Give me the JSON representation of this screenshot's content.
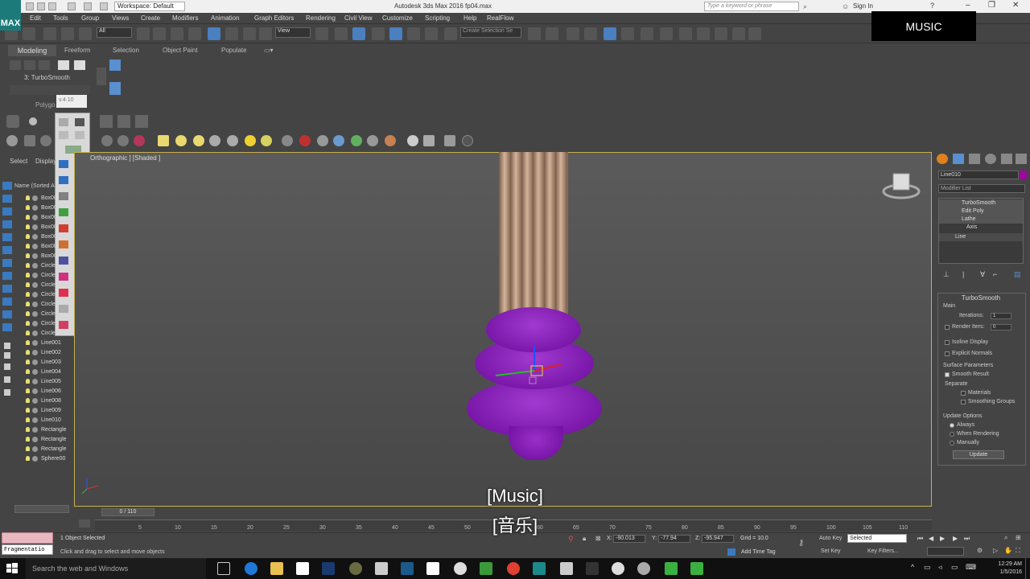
{
  "titlebar": {
    "logo_text": "MAX",
    "workspace": "Workspace: Default",
    "title": "Autodesk 3ds Max 2016    fp04.max",
    "search_placeholder": "Type a keyword or phrase",
    "sign_in": "Sign In"
  },
  "menus": [
    "Edit",
    "Tools",
    "Group",
    "Views",
    "Create",
    "Modifiers",
    "Animation",
    "Graph Editors",
    "Rendering",
    "Civil View",
    "Customize",
    "Scripting",
    "Help",
    "RealFlow"
  ],
  "toolbar": {
    "selection_filter": "All",
    "reference_coord": "View",
    "named_selection": "Create Selection Se"
  },
  "overlay": {
    "music_badge": "MUSIC"
  },
  "ribbon": {
    "tabs": [
      "Modeling",
      "Freeform",
      "Selection",
      "Object Paint",
      "Populate"
    ],
    "modifier_label": "3: TurboSmooth",
    "polygon_label": "Polygo",
    "version_tooltip": "v.4.10"
  },
  "explorer": {
    "tabs": [
      "Select",
      "Display"
    ],
    "header": "Name (Sorted A",
    "objects": [
      "Box00",
      "Box00",
      "Box00",
      "Box00",
      "Box00",
      "Box00",
      "Box00",
      "Circle",
      "Circle",
      "Circle",
      "Circle",
      "Circle",
      "Circle",
      "Circle",
      "Circle",
      "Line001",
      "Line002",
      "Line003",
      "Line004",
      "Line005",
      "Line006",
      "Line008",
      "Line009",
      "Line010",
      "Rectangle",
      "Rectangle",
      "Rectangle",
      "Sphere00"
    ]
  },
  "viewport": {
    "label": "Orthographic ] [Shaded ]",
    "column_color": "#c9a78d",
    "ring_color": "#8a1ec0"
  },
  "command_panel": {
    "object_name": "Line010",
    "object_color": "#9a0a9a",
    "modifier_list": "Modifier List",
    "stack": [
      "TurboSmooth",
      "Edit Poly",
      "Lathe",
      "Axis",
      "Line"
    ],
    "rollout_title": "TurboSmooth",
    "main_label": "Main",
    "iterations_label": "Iterations:",
    "iterations_value": "1",
    "render_iters_label": "Render Iters:",
    "render_iters_value": "0",
    "isoline_display": "Isoline Display",
    "explicit_normals": "Explicit Normals",
    "surface_params": "Surface Parameters",
    "smooth_result": "Smooth Result",
    "separate": "Separate",
    "materials": "Materials",
    "smoothing_groups": "Smoothing Groups",
    "update_options": "Update Options",
    "always": "Always",
    "when_rendering": "When Rendering",
    "manually": "Manually",
    "update_button": "Update"
  },
  "timeline": {
    "slider": "0 / 110",
    "ticks": [
      "5",
      "10",
      "15",
      "20",
      "25",
      "30",
      "35",
      "40",
      "45",
      "50",
      "55",
      "60",
      "65",
      "70",
      "75",
      "80",
      "85",
      "90",
      "95",
      "100",
      "105",
      "110"
    ]
  },
  "status": {
    "fragment_text": "Fragmentatio",
    "selected": "1 Object Selected",
    "prompt": "Click and drag to select and move objects",
    "x_label": "X:",
    "x_value": "-90.013",
    "y_label": "Y:",
    "y_value": "-77.94",
    "z_label": "Z:",
    "z_value": "-95.947",
    "grid": "Grid = 10.0",
    "add_time_tag": "Add Time Tag",
    "auto_key": "Auto Key",
    "key_mode": "Selected",
    "set_key": "Set Key",
    "key_filters": "Key Filters..."
  },
  "subtitles": {
    "en": "[Music]",
    "zh": "[音乐]"
  },
  "taskbar": {
    "search": "Search the web and Windows",
    "time": "12:29 AM",
    "date": "1/5/2016"
  }
}
